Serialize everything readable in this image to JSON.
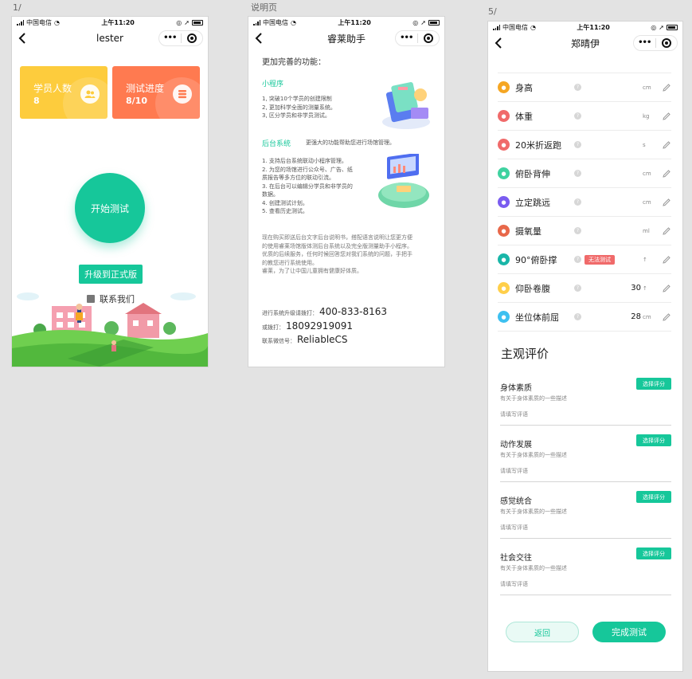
{
  "artboards": {
    "a1": "1/",
    "a2": "说明页",
    "a3": "5/"
  },
  "statusbar": {
    "carrier": "中国电信",
    "time": "上午11:20"
  },
  "colors": {
    "accent": "#16c79a",
    "yellow": "#fdcc3d",
    "orange": "#ff7a50",
    "badge_red": "#f06a6a"
  },
  "icons": {
    "back": "chevron-left-icon",
    "more": "more-dots-icon",
    "close": "target-icon"
  },
  "phone1": {
    "title": "lester",
    "cards": [
      {
        "label": "学员人数",
        "value": "8",
        "icon": "users-icon"
      },
      {
        "label": "测试进度",
        "value": "8/10",
        "icon": "list-icon"
      }
    ],
    "start_button": "开始测试",
    "upgrade_button": "升级到正式版",
    "contact": "联系我们"
  },
  "phone2": {
    "title": "睿莱助手",
    "intro": "更加完善的功能：",
    "miniprogram_heading": "小程序",
    "miniprogram_items": [
      "1, 突破10个学员的创建限制",
      "2, 更加科学全面的测量系统。",
      "3, 区分学员和非学员测试。"
    ],
    "backend_heading": "后台系统",
    "backend_desc": "更强大的功能帮助您进行场馆管理。",
    "backend_items": [
      "1. 支持后台系统联动小程序管理。",
      "2. 为您的场馆进行公众号、广告、纸",
      "质报告等多方位的联动引流。",
      "3. 在后台可以编辑分学员和非学员的",
      "数据。",
      "4. 创建测试计划。",
      "5. 查看历史测试。"
    ],
    "paragraph": [
      "现在购买即送后台文字后台说明书，搭配语言说明让您更方便",
      "的使用睿莱场馆版体测后台系统以及完全版测量助手小程序。",
      "优质的后续服务，任何时候回答您对我们系统的问题，手把手",
      "的教您进行系统使用。",
      "睿莱，为了让中国儿童拥有健康好体质。"
    ],
    "phone_label": "进行系统升级请拨打：",
    "phone_number": "400-833-8163",
    "alt_label": "或拨打：",
    "alt_number": "18092919091",
    "wechat_label": "联系微信号：",
    "wechat_id": "ReliableCS"
  },
  "phone3": {
    "title": "郑晴伊",
    "measurements": [
      {
        "name": "身高",
        "unit": "cm",
        "value": "",
        "icon_color": "#f5a623",
        "icon": "height-icon"
      },
      {
        "name": "体重",
        "unit": "kg",
        "value": "",
        "icon_color": "#f06a6a",
        "icon": "weight-icon"
      },
      {
        "name": "20米折返跑",
        "unit": "s",
        "value": "",
        "icon_color": "#f06a6a",
        "icon": "run-icon"
      },
      {
        "name": "俯卧背伸",
        "unit": "cm",
        "value": "",
        "icon_color": "#3fd2a0",
        "icon": "stretch-icon"
      },
      {
        "name": "立定跳远",
        "unit": "cm",
        "value": "",
        "icon_color": "#7a5cf0",
        "icon": "jump-icon"
      },
      {
        "name": "摄氧量",
        "unit": "ml",
        "value": "",
        "icon_color": "#e8684a",
        "icon": "oxygen-icon"
      },
      {
        "name": "90°俯卧撑",
        "unit": "↑",
        "value": "",
        "icon_color": "#19b6a8",
        "icon": "pushup-icon",
        "badge": "无法测试"
      },
      {
        "name": "仰卧卷腹",
        "unit": "↑",
        "value": "30",
        "icon_color": "#ffcf4a",
        "icon": "situp-icon"
      },
      {
        "name": "坐位体前屈",
        "unit": "cm",
        "value": "28",
        "icon_color": "#3dc0f0",
        "icon": "sitreach-icon"
      }
    ],
    "subjective_title": "主观评价",
    "evals": [
      {
        "title": "身体素质",
        "desc": "有关于身体素质的一些描述",
        "placeholder": "请填写评语",
        "button": "选择评分"
      },
      {
        "title": "动作发展",
        "desc": "有关于身体素质的一些描述",
        "placeholder": "请填写评语",
        "button": "选择评分"
      },
      {
        "title": "感觉统合",
        "desc": "有关于身体素质的一些描述",
        "placeholder": "请填写评语",
        "button": "选择评分"
      },
      {
        "title": "社会交往",
        "desc": "有关于身体素质的一些描述",
        "placeholder": "请填写评语",
        "button": "选择评分"
      }
    ],
    "back_button": "返回",
    "done_button": "完成测试"
  }
}
